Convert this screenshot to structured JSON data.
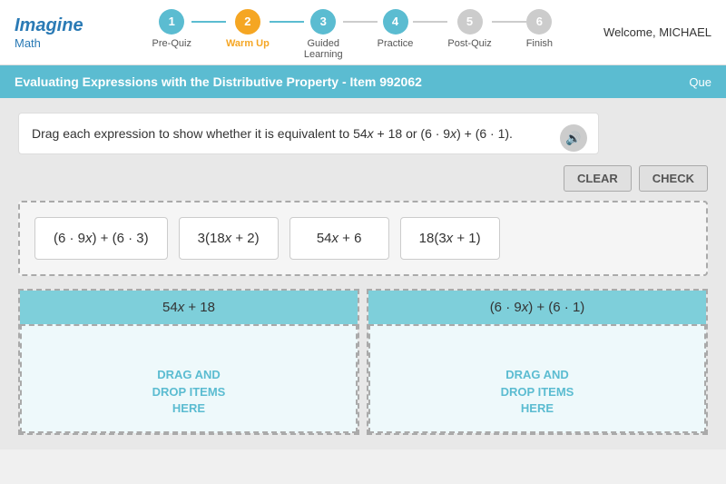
{
  "header": {
    "logo_imagine": "Imagine",
    "logo_math": "Math",
    "welcome": "Welcome, MICHAEL",
    "steps": [
      {
        "number": "1",
        "label": "Pre-Quiz",
        "state": "active"
      },
      {
        "number": "2",
        "label": "Warm Up",
        "state": "current"
      },
      {
        "number": "3",
        "label": "Guided\nLearning",
        "state": "next"
      },
      {
        "number": "4",
        "label": "Practice",
        "state": "next"
      },
      {
        "number": "5",
        "label": "Post-Quiz",
        "state": "next"
      },
      {
        "number": "6",
        "label": "Finish",
        "state": "next"
      }
    ]
  },
  "title_bar": {
    "text": "Evaluating Expressions with the Distributive Property - Item 992062",
    "right_label": "Que"
  },
  "instructions": "Drag each expression to show whether it is equivalent to 54x + 18 or (6 · 9x) + (6 · 1).",
  "buttons": {
    "clear": "CLEAR",
    "check": "CHECK"
  },
  "drag_items": [
    {
      "id": "item1",
      "label": "(6 · 9x) + (6 · 3)"
    },
    {
      "id": "item2",
      "label": "3(18x + 2)"
    },
    {
      "id": "item3",
      "label": "54x + 6"
    },
    {
      "id": "item4",
      "label": "18(3x + 1)"
    }
  ],
  "drop_zones": [
    {
      "id": "zone1",
      "header": "54x + 18",
      "hint": "DRAG AND\nDROP ITEMS\nHERE"
    },
    {
      "id": "zone2",
      "header": "(6 · 9x) + (6 · 1)",
      "hint": "DRAG AND\nDROP ITEMS\nHERE"
    }
  ],
  "audio_icon": "🔊"
}
